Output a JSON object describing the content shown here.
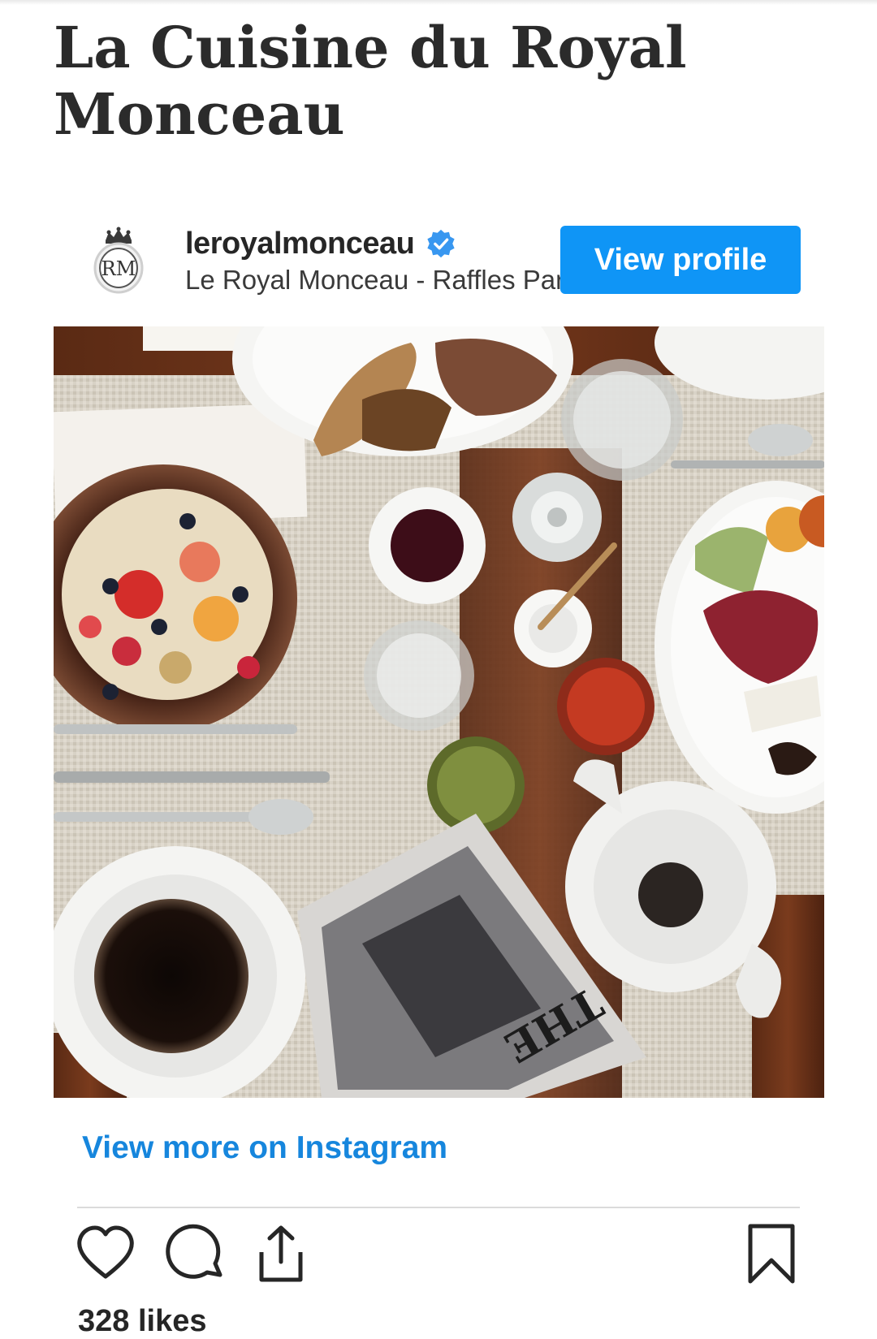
{
  "article": {
    "title": "La Cuisine du Royal Monceau"
  },
  "embed": {
    "account": {
      "avatar_icon": "rm-monogram-crest-icon",
      "avatar_monogram": "RM",
      "username": "leroyalmonceau",
      "verified_icon": "verified-badge-icon",
      "display_name": "Le Royal Monceau - Raffles Paris",
      "view_profile_label": "View profile"
    },
    "post": {
      "image_description_icon": "breakfast-table-photo",
      "view_more_label": "View more on Instagram",
      "actions": {
        "like_icon": "heart-icon",
        "comment_icon": "comment-bubble-icon",
        "share_icon": "share-icon",
        "save_icon": "bookmark-icon"
      },
      "likes": "328 likes"
    }
  },
  "colors": {
    "accent": "#0f95f6",
    "link": "#1686dd",
    "text": "#262626",
    "divider": "#dbdbdb",
    "verified": "#3897f0"
  }
}
